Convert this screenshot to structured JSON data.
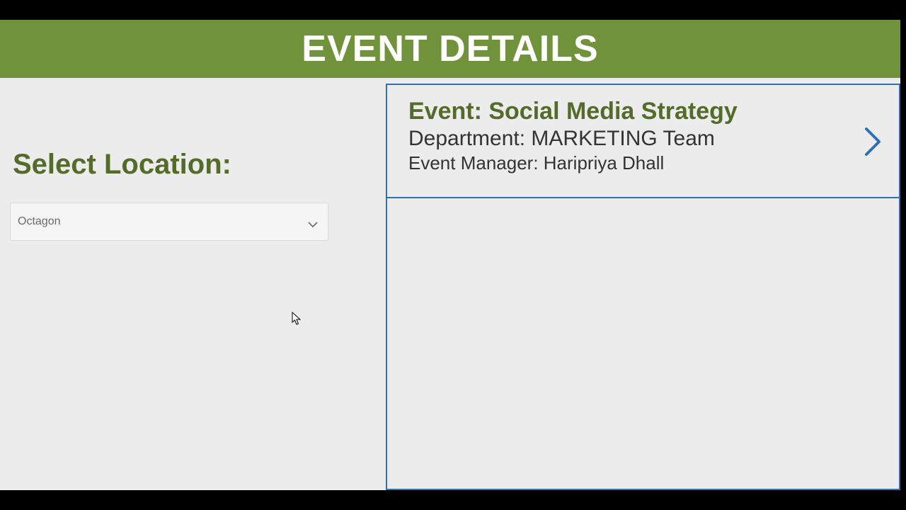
{
  "header": {
    "title": "EVENT DETAILS"
  },
  "left": {
    "select_label": "Select Location:",
    "location_value": "Octagon"
  },
  "event_card": {
    "line1_prefix": "Event: ",
    "event_name": "Social Media Strategy",
    "line2_prefix": "Department: ",
    "department": "MARKETING Team",
    "line3_prefix": "Event Manager: ",
    "manager": "Haripriya Dhall"
  },
  "colors": {
    "header_bg": "#6f923a",
    "accent_blue": "#2f6fb3",
    "label_green": "#546b2a"
  }
}
